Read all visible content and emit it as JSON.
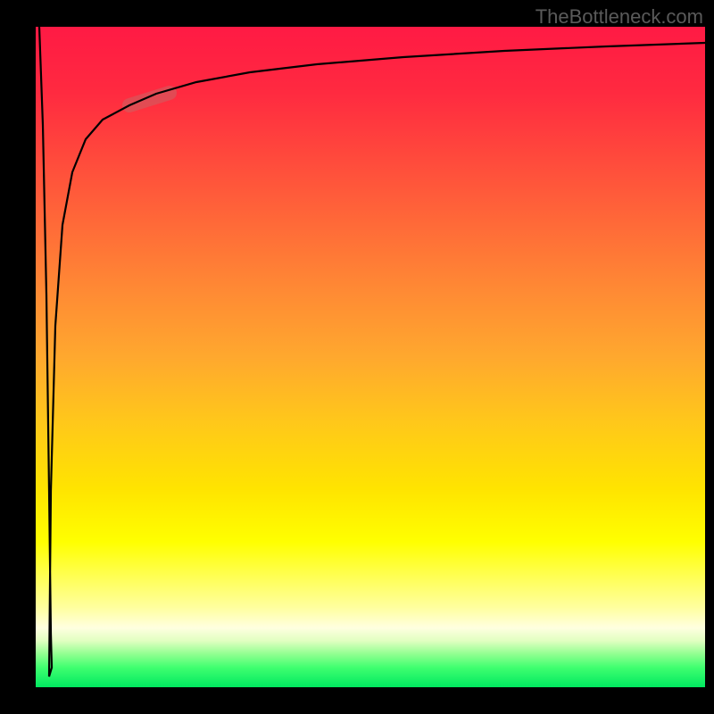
{
  "watermark": "TheBottleneck.com",
  "colors": {
    "gradient_top": "#ff1a44",
    "gradient_mid": "#ffff00",
    "gradient_bottom": "#00e860",
    "curve": "#000000",
    "highlight": "rgba(200,100,100,0.55)",
    "plot_frame": "#000000"
  },
  "chart_data": {
    "type": "line",
    "title": "",
    "xlabel": "",
    "ylabel": "",
    "xlim": [
      0,
      100
    ],
    "ylim": [
      0,
      100
    ],
    "series": [
      {
        "name": "curve",
        "x": [
          0.5,
          1.0,
          1.5,
          2.0,
          2.3,
          2.0,
          2.3,
          3.0,
          4.0,
          5.5,
          7.5,
          10,
          14,
          18,
          24,
          32,
          42,
          55,
          70,
          85,
          100
        ],
        "values": [
          100,
          85,
          60,
          30,
          8,
          3,
          30,
          55,
          70,
          78,
          83,
          86,
          88,
          90,
          91.5,
          93,
          94,
          95,
          95.8,
          96.4,
          97
        ]
      }
    ],
    "highlight_segment": {
      "x_start": 14,
      "x_end": 20,
      "note": "salmon overlay on ascending curve"
    }
  }
}
